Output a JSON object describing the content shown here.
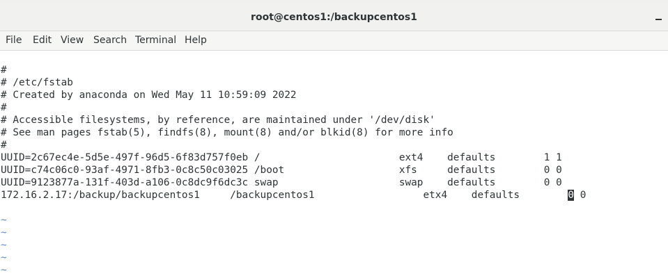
{
  "window": {
    "title": "root@centos1:/backupcentos1"
  },
  "menubar": {
    "items": [
      "File",
      "Edit",
      "View",
      "Search",
      "Terminal",
      "Help"
    ]
  },
  "terminal": {
    "lines": [
      "#",
      "# /etc/fstab",
      "# Created by anaconda on Wed May 11 10:59:09 2022",
      "#",
      "# Accessible filesystems, by reference, are maintained under '/dev/disk'",
      "# See man pages fstab(5), findfs(8), mount(8) and/or blkid(8) for more info",
      "#",
      "UUID=2c67ec4e-5d5e-497f-96d5-6f83d757f0eb /                       ext4    defaults        1 1",
      "UUID=c74c06c0-93af-4971-8fb3-0c8c50c03025 /boot                   xfs     defaults        0 0",
      "UUID=9123877a-131f-403d-a106-0c8dc9f6dc3c swap                    swap    defaults        0 0",
      ""
    ],
    "last_line": {
      "before_cursor": "172.16.2.17:/backup/backupcentos1     /backupcentos1                  etx4    defaults        ",
      "cursor_char": "0",
      "after_cursor": " 0"
    },
    "tilde_lines": [
      "~",
      "~",
      "~",
      "~",
      "~"
    ]
  }
}
